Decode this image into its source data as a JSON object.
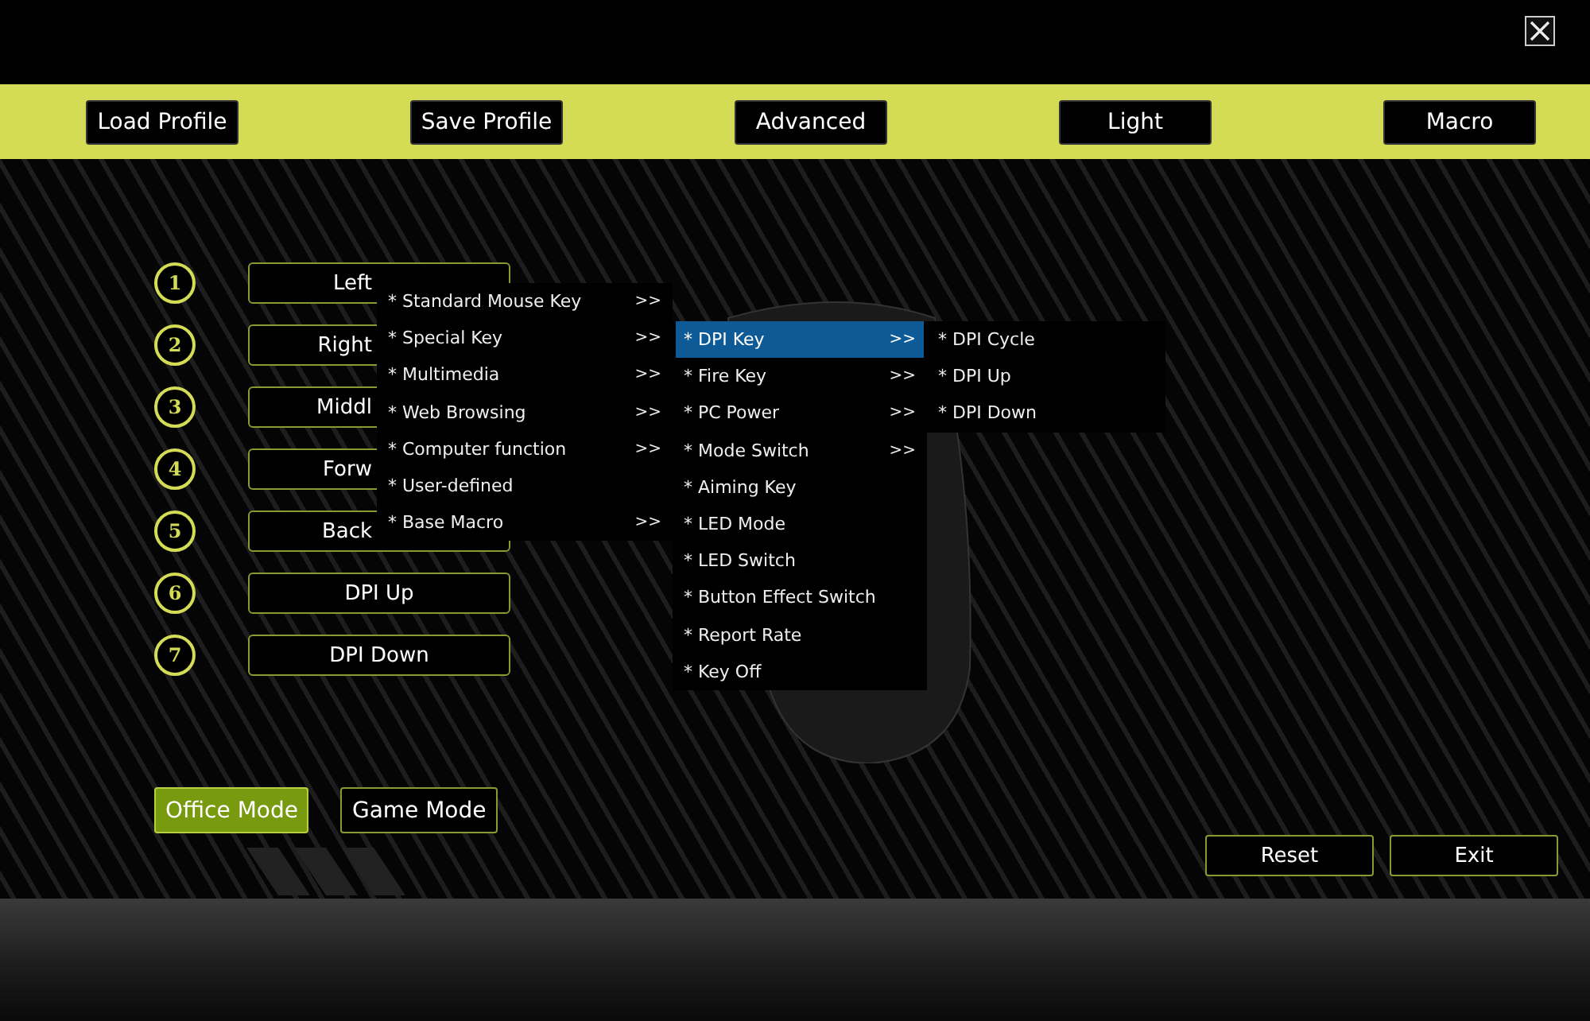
{
  "toolbar": [
    {
      "label": "Load Profile"
    },
    {
      "label": "Save Profile"
    },
    {
      "label": "Advanced"
    },
    {
      "label": "Light"
    },
    {
      "label": "Macro"
    }
  ],
  "key_bindings": [
    {
      "number": "1",
      "label": "Left"
    },
    {
      "number": "2",
      "label": "Right"
    },
    {
      "number": "3",
      "label": "Middl"
    },
    {
      "number": "4",
      "label": "Forw"
    },
    {
      "number": "5",
      "label": "Back"
    },
    {
      "number": "6",
      "label": "DPI Up"
    },
    {
      "number": "7",
      "label": "DPI Down"
    }
  ],
  "menus": [
    {
      "items": [
        {
          "label": "* Standard Mouse Key",
          "arrow": ">>",
          "selected": false
        },
        {
          "label": "* Special Key",
          "arrow": ">>",
          "selected": false
        },
        {
          "label": "* Multimedia",
          "arrow": ">>",
          "selected": false
        },
        {
          "label": "* Web Browsing",
          "arrow": ">>",
          "selected": false
        },
        {
          "label": "* Computer function",
          "arrow": ">>",
          "selected": false
        },
        {
          "label": "* User-defined",
          "selected": false
        },
        {
          "label": "* Base Macro",
          "arrow": ">>",
          "selected": false
        }
      ]
    },
    {
      "items": [
        {
          "label": "* DPI Key",
          "arrow": ">>",
          "selected": true
        },
        {
          "label": "* Fire Key",
          "arrow": ">>",
          "selected": false
        },
        {
          "label": "* PC Power",
          "arrow": ">>",
          "selected": false
        },
        {
          "label": "* Mode Switch",
          "arrow": ">>",
          "selected": false
        },
        {
          "label": "* Aiming Key",
          "selected": false
        },
        {
          "label": "* LED Mode",
          "selected": false
        },
        {
          "label": "* LED Switch",
          "selected": false
        },
        {
          "label": "* Button Effect Switch",
          "selected": false
        },
        {
          "label": "* Report Rate",
          "selected": false
        },
        {
          "label": "* Key Off",
          "selected": false
        }
      ]
    },
    {
      "items": [
        {
          "label": "* DPI Cycle",
          "selected": false
        },
        {
          "label": "* DPI Up",
          "selected": false
        },
        {
          "label": "* DPI Down",
          "selected": false
        }
      ]
    }
  ],
  "modes": [
    {
      "label": "Office Mode",
      "selected": true
    },
    {
      "label": "Game Mode",
      "selected": false
    }
  ],
  "footer_buttons": [
    {
      "label": "Reset"
    },
    {
      "label": "Exit"
    }
  ]
}
